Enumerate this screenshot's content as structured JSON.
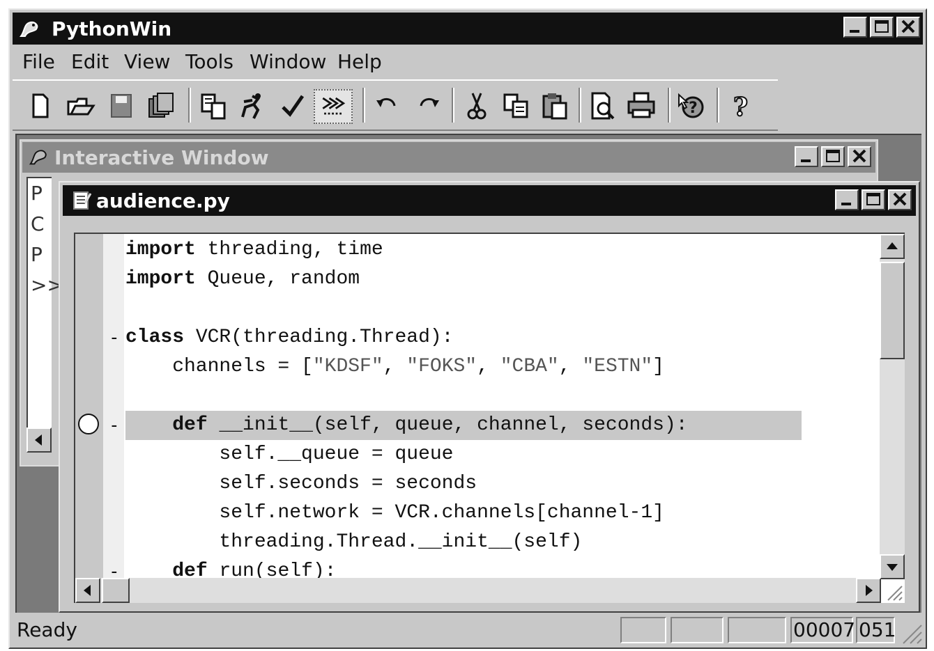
{
  "app": {
    "title": "PythonWin",
    "menu": [
      {
        "label": "File",
        "id": "file"
      },
      {
        "label": "Edit",
        "id": "edit"
      },
      {
        "label": "View",
        "id": "view"
      },
      {
        "label": "Tools",
        "id": "tools"
      },
      {
        "label": "Window",
        "id": "window"
      },
      {
        "label": "Help",
        "id": "help"
      }
    ],
    "toolbar_icons": [
      "new-file-icon",
      "open-folder-icon",
      "save-icon",
      "save-all-icon",
      "import-icon",
      "run-icon",
      "check-icon",
      "interactive-window-icon",
      "undo-icon",
      "redo-icon",
      "cut-icon",
      "copy-icon",
      "paste-icon",
      "print-preview-icon",
      "print-icon",
      "help-context-icon",
      "help-icon"
    ]
  },
  "interactive_window": {
    "title": "Interactive Window",
    "lines": [
      "P",
      "C",
      "P",
      ">>"
    ]
  },
  "editor_window": {
    "title": "audience.py",
    "code_lines": [
      {
        "tokens": [
          {
            "t": "import",
            "k": "kw"
          },
          {
            "t": " threading, time"
          }
        ]
      },
      {
        "tokens": [
          {
            "t": "import",
            "k": "kw"
          },
          {
            "t": " Queue, random"
          }
        ]
      },
      {
        "tokens": [
          {
            "t": ""
          }
        ]
      },
      {
        "tokens": [
          {
            "t": "class",
            "k": "kw"
          },
          {
            "t": " VCR(threading.Thread):"
          }
        ],
        "fold": "-"
      },
      {
        "tokens": [
          {
            "t": "    channels = ["
          },
          {
            "t": "\"KDSF\"",
            "k": "str"
          },
          {
            "t": ", "
          },
          {
            "t": "\"FOKS\"",
            "k": "str"
          },
          {
            "t": ", "
          },
          {
            "t": "\"CBA\"",
            "k": "str"
          },
          {
            "t": ", "
          },
          {
            "t": "\"ESTN\"",
            "k": "str"
          },
          {
            "t": "]"
          }
        ]
      },
      {
        "tokens": [
          {
            "t": ""
          }
        ]
      },
      {
        "tokens": [
          {
            "t": "    "
          },
          {
            "t": "def",
            "k": "kw"
          },
          {
            "t": " __init__(self, queue, channel, seconds):"
          }
        ],
        "fold": "-",
        "highlight": true,
        "breakpoint": true
      },
      {
        "tokens": [
          {
            "t": "        self.__queue = queue"
          }
        ]
      },
      {
        "tokens": [
          {
            "t": "        self.seconds = seconds"
          }
        ]
      },
      {
        "tokens": [
          {
            "t": "        self.network = VCR.channels[channel-1]"
          }
        ]
      },
      {
        "tokens": [
          {
            "t": "        threading.Thread.__init__(self)"
          }
        ]
      },
      {
        "tokens": [
          {
            "t": "    "
          },
          {
            "t": "def",
            "k": "kw"
          },
          {
            "t": " run(self):"
          }
        ],
        "fold": "-"
      }
    ]
  },
  "status": {
    "text": "Ready",
    "line": "00007",
    "col": "051"
  }
}
